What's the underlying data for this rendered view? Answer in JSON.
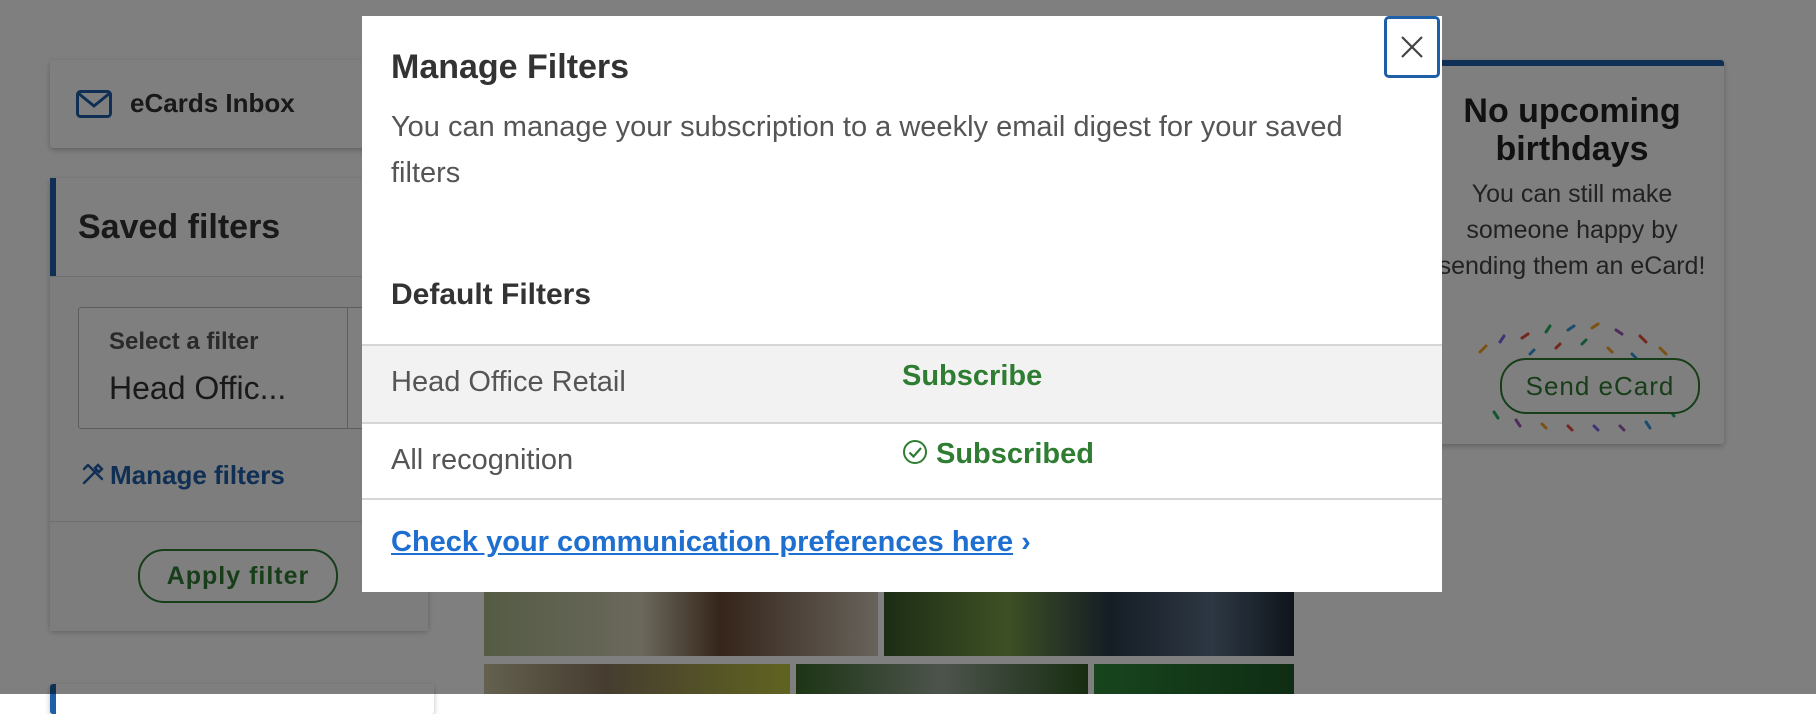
{
  "sidebar": {
    "inbox_label": "eCards Inbox",
    "saved_filters_title": "Saved filters",
    "select_caption": "Select a filter",
    "select_value": "Head Offic...",
    "manage_link": "Manage filters",
    "apply_button": "Apply filter"
  },
  "birthdays": {
    "title": "No upcoming birthdays",
    "description": "You can still make someone happy by sending them an eCard!",
    "send_button": "Send eCard"
  },
  "modal": {
    "title": "Manage Filters",
    "description": "You can manage your subscription to a weekly email digest for your saved filters",
    "section_title": "Default Filters",
    "rows": [
      {
        "name": "Head Office Retail",
        "action": "Subscribe"
      },
      {
        "name": "All recognition",
        "action": "Subscribed"
      }
    ],
    "pref_link": "Check your communication preferences here",
    "pref_chevron": "›"
  },
  "colors": {
    "accent_blue": "#1e5fa8",
    "link_blue": "#1e6fd0",
    "success_green": "#2e7d32"
  },
  "icons": [
    "envelope-icon",
    "tools-icon",
    "close-icon",
    "check-circle-icon",
    "chevron-right-icon",
    "confetti-icon"
  ]
}
